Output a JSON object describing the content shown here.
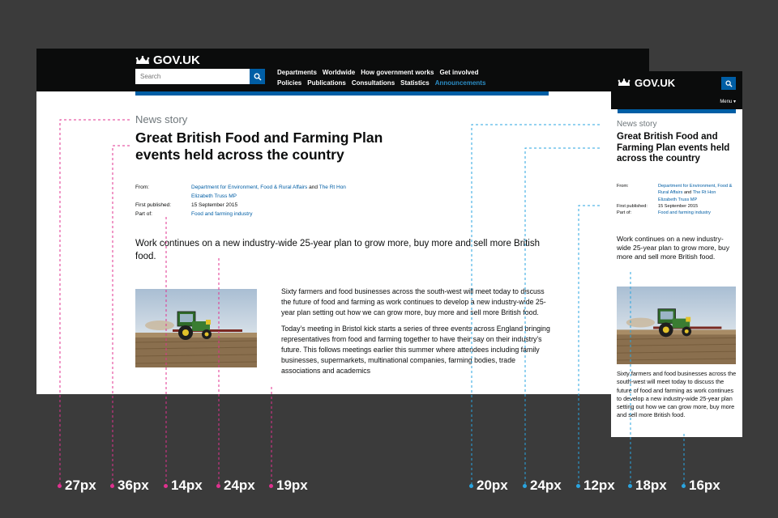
{
  "colors": {
    "magenta": "#e0318f",
    "cyan": "#2aa5e0",
    "govuk_blue": "#005ea5",
    "header_black": "#0b0c0c"
  },
  "desktop": {
    "logo_text": "GOV.UK",
    "search_placeholder": "Search",
    "nav_row1": [
      "Departments",
      "Worldwide",
      "How government works",
      "Get involved"
    ],
    "nav_row2": [
      "Policies",
      "Publications",
      "Consultations",
      "Statistics",
      "Announcements"
    ],
    "kicker": "News story",
    "title": "Great British Food and Farming Plan events held across the country",
    "meta": {
      "from_label": "From:",
      "from_link1": "Department for Environment, Food & Rural Affairs",
      "from_and": "and",
      "from_link2": "The Rt Hon Elizabeth Truss MP",
      "published_label": "First published:",
      "published_value": "15 September 2015",
      "partof_label": "Part of:",
      "partof_link": "Food and farming industry"
    },
    "lede": "Work continues on a new industry-wide 25-year plan to grow more, buy more and sell more British food.",
    "body_p1": "Sixty farmers and food businesses across the south-west will meet today to discuss the future of food and farming as work continues to develop a new industry-wide 25-year plan setting out how we can grow more, buy more and sell more British food.",
    "body_p2": "Today’s meeting in Bristol kick starts a series of three events across England bringing representatives from food and farming together to have their say on their industry’s future. This follows meetings earlier this summer where attendees including family businesses, supermarkets, multinational companies, farming bodies, trade associations and academics"
  },
  "mobile": {
    "logo_text": "GOV.UK",
    "menu_label": "Menu ▾",
    "kicker": "News story",
    "title": "Great British Food and Farming Plan events held across the country",
    "meta": {
      "from_label": "From:",
      "from_link1": "Department for Environment, Food & Rural Affairs",
      "from_and": "and",
      "from_link2": "The Rt Hon Elizabeth Truss MP",
      "published_label": "First published:",
      "published_value": "15 September 2015",
      "partof_label": "Part of:",
      "partof_link": "Food and farming industry"
    },
    "lede": "Work continues on a new industry-wide 25-year plan to grow more, buy more and sell more British food.",
    "body": "Sixty farmers and food businesses across the south-west will meet today to discuss the future of food and farming as work continues to develop a new industry-wide 25-year plan setting out how we can grow more, buy more and sell more British food."
  },
  "annotations": {
    "desktop_sizes": [
      "27px",
      "36px",
      "14px",
      "24px",
      "19px"
    ],
    "mobile_sizes": [
      "20px",
      "24px",
      "12px",
      "18px",
      "16px"
    ]
  }
}
